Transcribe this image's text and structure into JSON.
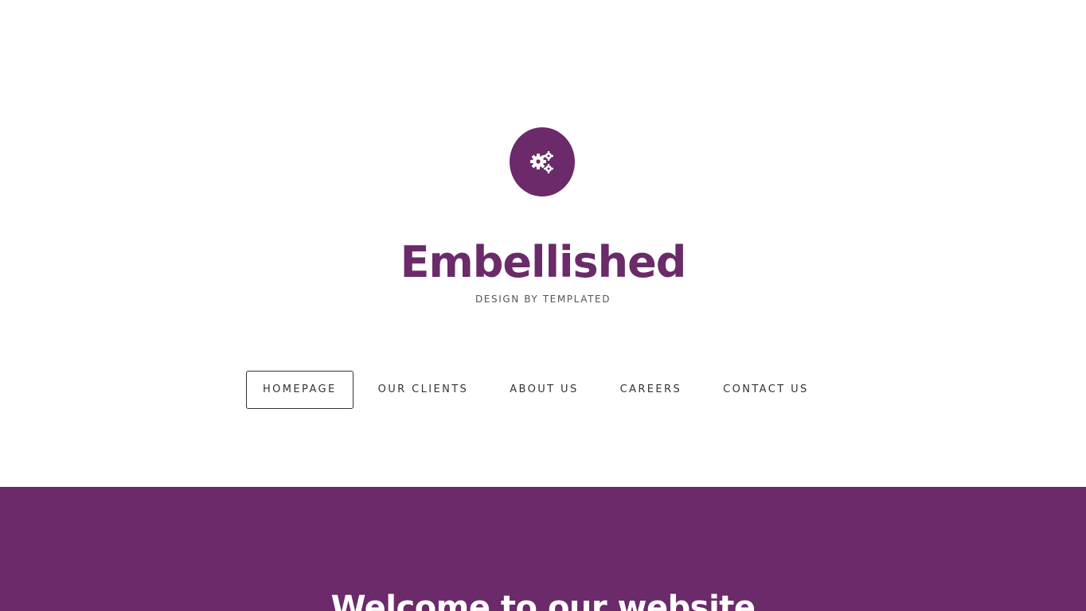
{
  "site": {
    "title": "Embellished",
    "tagline": "DESIGN BY TEMPLATED",
    "logo_icon": "gears-icon"
  },
  "nav": {
    "items": [
      {
        "label": "HOMEPAGE",
        "active": true
      },
      {
        "label": "OUR CLIENTS",
        "active": false
      },
      {
        "label": "ABOUT US",
        "active": false
      },
      {
        "label": "CAREERS",
        "active": false
      },
      {
        "label": "CONTACT US",
        "active": false
      }
    ]
  },
  "banner": {
    "heading": "Welcome to our website"
  },
  "colors": {
    "brand": "#6b2a69",
    "text": "#333333",
    "background": "#ffffff"
  }
}
